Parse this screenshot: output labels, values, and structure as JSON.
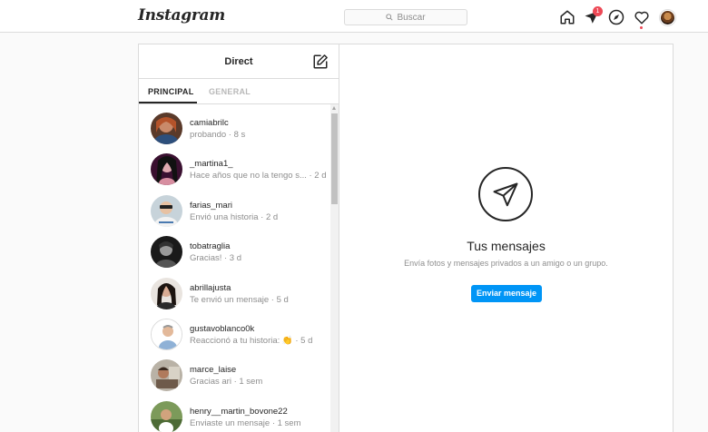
{
  "header": {
    "logo": "Instagram",
    "search_placeholder": "Buscar",
    "icons": [
      "home-icon",
      "direct-icon",
      "explore-icon",
      "activity-icon",
      "profile-avatar"
    ],
    "direct_badge": "1"
  },
  "direct": {
    "title": "Direct",
    "tabs": [
      {
        "label": "PRINCIPAL",
        "active": true
      },
      {
        "label": "GENERAL",
        "active": false
      }
    ],
    "conversations": [
      {
        "username": "camiabrilc",
        "preview": "probando · 8 s"
      },
      {
        "username": "_martina1_",
        "preview": "Hace años que no la tengo s... · 2 d"
      },
      {
        "username": "farias_mari",
        "preview": "Envió una historia · 2 d"
      },
      {
        "username": "tobatraglia",
        "preview": "Gracias! · 3 d"
      },
      {
        "username": "abrillajusta",
        "preview": "Te envió un mensaje · 5 d"
      },
      {
        "username": "gustavoblanco0k",
        "preview": "Reaccionó a tu historia: 👏 · 5 d"
      },
      {
        "username": "marce_laise",
        "preview": "Gracias ari · 1 sem"
      },
      {
        "username": "henry__martin_bovone22",
        "preview": "Enviaste un mensaje · 1 sem"
      }
    ]
  },
  "empty_state": {
    "title": "Tus mensajes",
    "subtitle": "Envía fotos y mensajes privados a un amigo o un grupo.",
    "button": "Enviar mensaje"
  },
  "colors": {
    "accent": "#0095f6",
    "badge": "#ed4956",
    "border": "#dbdbdb",
    "muted_text": "#8e8e8e"
  }
}
